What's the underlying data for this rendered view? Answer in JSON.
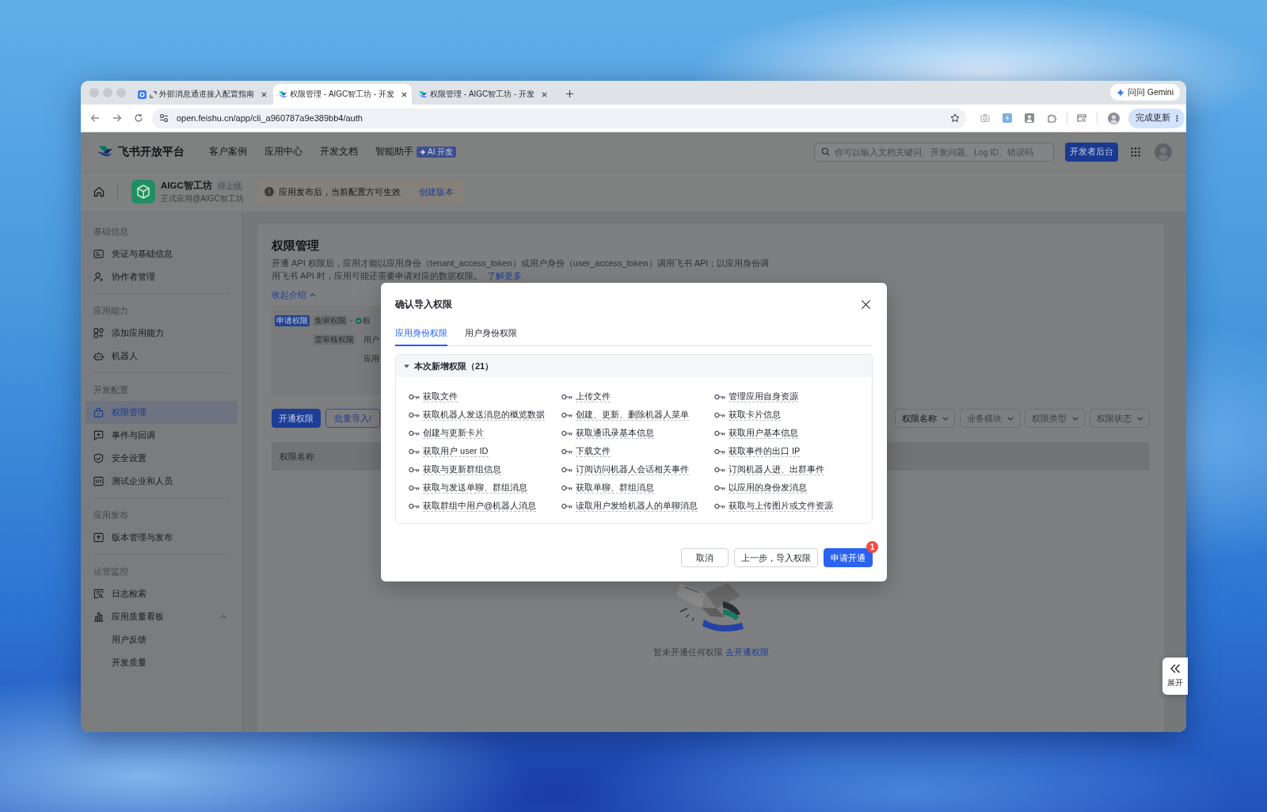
{
  "browser": {
    "tabs": [
      {
        "title": "外部消息通道接入配置指南",
        "selected": false,
        "kind": "docs"
      },
      {
        "title": "权限管理 - AIGC智工坊 - 开发",
        "selected": true,
        "kind": "app"
      },
      {
        "title": "权限管理 - AIGC智工坊 - 开发",
        "selected": false,
        "kind": "app"
      }
    ],
    "gemini_button": "问问 Gemini",
    "url": "open.feishu.cn/app/cli_a960787a9e389bb4/auth",
    "update_button": "完成更新"
  },
  "header": {
    "brand": "飞书开放平台",
    "nav": [
      {
        "label": "客户案例"
      },
      {
        "label": "应用中心"
      },
      {
        "label": "开发文档"
      },
      {
        "label": "智能助手",
        "badge": "AI 开发"
      }
    ],
    "search": {
      "placeholder": "你可以输入文档关键词、开发问题、Log ID、错误码"
    },
    "console_button": "开发者后台"
  },
  "app_bar": {
    "app_name": "AIGC智工坊",
    "status": "待上线",
    "subtitle": "正式应用@AIGC智工坊",
    "notice": "应用发布后，当前配置方可生效",
    "notice_link": "创建版本"
  },
  "sidebar": {
    "sections": [
      {
        "title": "基础信息",
        "items": [
          {
            "label": "凭证与基础信息",
            "selected": false
          },
          {
            "label": "协作者管理",
            "selected": false
          }
        ]
      },
      {
        "title": "应用能力",
        "items": [
          {
            "label": "添加应用能力",
            "selected": false
          },
          {
            "label": "机器人",
            "selected": false
          }
        ]
      },
      {
        "title": "开发配置",
        "items": [
          {
            "label": "权限管理",
            "selected": true
          },
          {
            "label": "事件与回调",
            "selected": false
          },
          {
            "label": "安全设置",
            "selected": false
          },
          {
            "label": "测试企业和人员",
            "selected": false
          }
        ]
      },
      {
        "title": "应用发布",
        "items": [
          {
            "label": "版本管理与发布",
            "selected": false
          }
        ]
      },
      {
        "title": "运营监控",
        "items": [
          {
            "label": "日志检索",
            "selected": false
          },
          {
            "label": "应用质量看板",
            "selected": false,
            "expanded": true,
            "children": [
              {
                "label": "用户反馈",
                "selected": false
              },
              {
                "label": "开发质量",
                "selected": false
              }
            ]
          }
        ]
      }
    ]
  },
  "content": {
    "title": "权限管理",
    "description": "开通 API 权限后，应用才能以应用身份（tenant_access_token）或用户身份（user_access_token）调用飞书 API；以应用身份调用飞书 API 时，应用可能还需要申请对应的数据权限。",
    "learn_more": "了解更多",
    "collapse_link": "收起介绍",
    "intro_diagram": {
      "start": "申请权限",
      "rows": [
        {
          "kind": "approved",
          "tag": "免审权限",
          "result": "权"
        },
        {
          "kind": "plain",
          "tag": "需审核权限",
          "result": "用户"
        },
        {
          "kind": "plain",
          "result": "应用"
        }
      ]
    },
    "buttons": [
      {
        "label": "开通权限",
        "kind": "primary"
      },
      {
        "label": "批量导入/",
        "kind": "default"
      }
    ],
    "filters": [
      {
        "label": "权限名称",
        "filled": true
      },
      {
        "label": "业务模块",
        "filled": false
      },
      {
        "label": "权限类型",
        "filled": false
      },
      {
        "label": "权限状态",
        "filled": false
      }
    ],
    "table": {
      "columns": [
        "权限名称"
      ]
    },
    "empty_state": {
      "text": "暂未开通任何权限",
      "link": "去开通权限"
    }
  },
  "dialog": {
    "title": "确认导入权限",
    "tabs": [
      {
        "label": "应用身份权限",
        "selected": true
      },
      {
        "label": "用户身份权限",
        "selected": false
      }
    ],
    "group": {
      "title": "本次新增权限（21）",
      "expanded": true,
      "items": [
        "获取文件",
        "上传文件",
        "管理应用自身资源",
        "获取机器人发送消息的概览数据",
        "创建、更新、删除机器人菜单",
        "获取卡片信息",
        "创建与更新卡片",
        "获取通讯录基本信息",
        "获取用户基本信息",
        "获取用户 user ID",
        "下载文件",
        "获取事件的出口 IP",
        "获取与更新群组信息",
        "订阅访问机器人会话相关事件",
        "订阅机器人进、出群事件",
        "获取与发送单聊、群组消息",
        "获取单聊、群组消息",
        "以应用的身份发消息",
        "获取群组中用户@机器人消息",
        "读取用户发给机器人的单聊消息",
        "获取与上传图片或文件资源"
      ]
    },
    "buttons": [
      {
        "label": "取消",
        "kind": "default"
      },
      {
        "label": "上一步，导入权限",
        "kind": "default"
      },
      {
        "label": "申请开通",
        "kind": "primary",
        "badge": "1"
      }
    ]
  },
  "expand_button": "展开"
}
